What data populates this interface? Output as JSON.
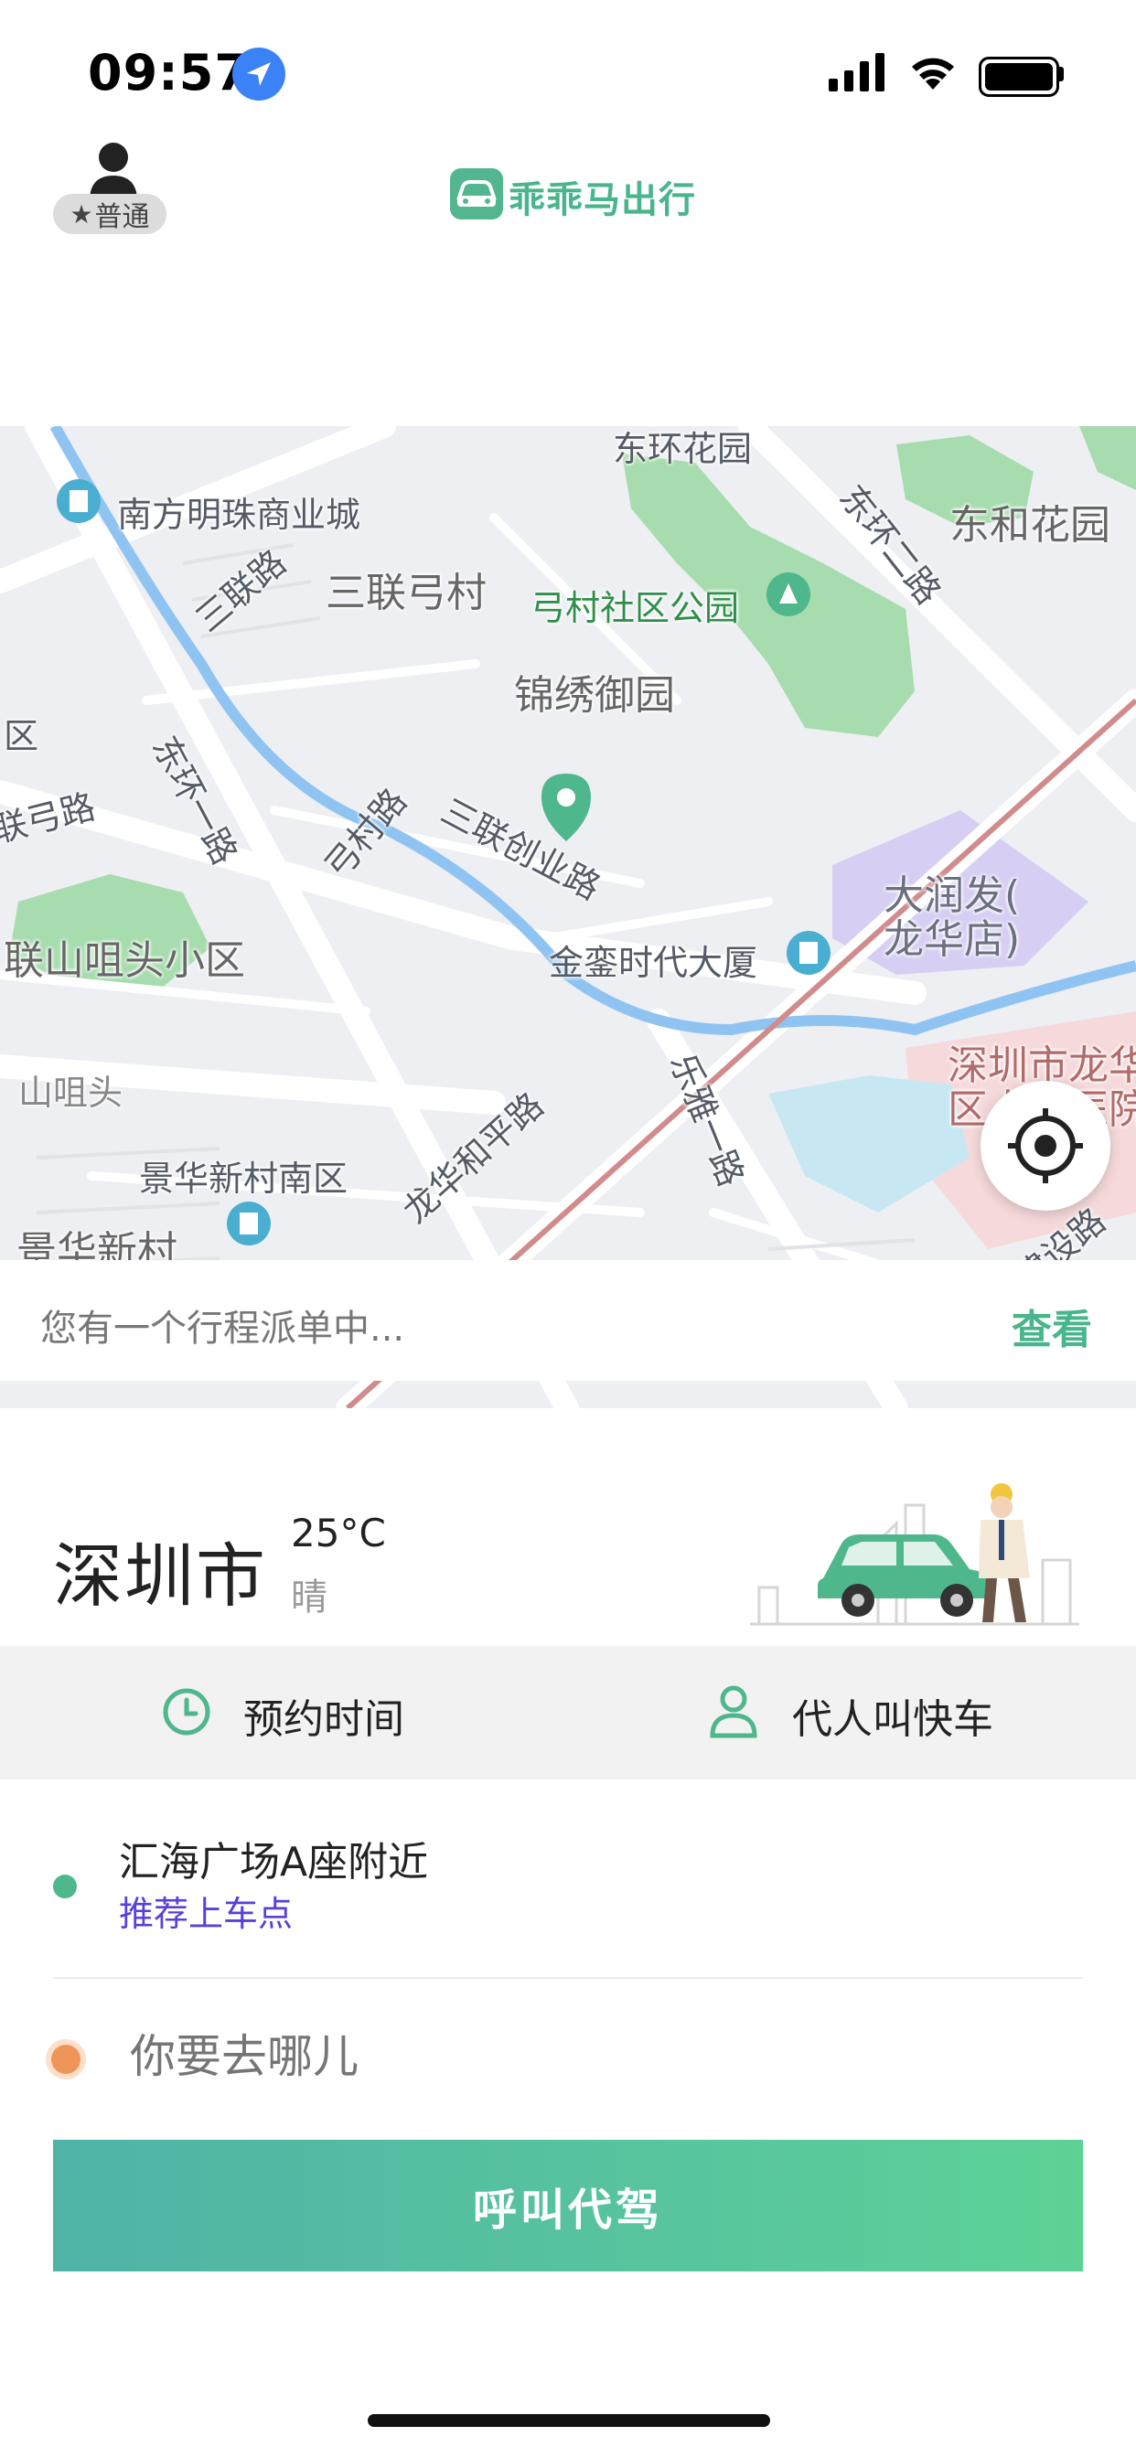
{
  "status_bar": {
    "time": "09:57",
    "icons": [
      "location-arrow-icon",
      "cellular-signal-icon",
      "wifi-icon",
      "battery-icon"
    ]
  },
  "header": {
    "member_badge": "普通",
    "member_icon": "star-icon",
    "avatar_icon": "user-avatar-icon",
    "logo_text": "乖乖马出行",
    "logo_icon": "car-logo-icon"
  },
  "map": {
    "labels": {
      "nanfang": "南方明珠商业城",
      "sanlian_road": "三联路",
      "sanlian_gongcun": "三联弓村",
      "gongcun_park": "弓村社区公园",
      "donghuan_road_top": "东环二路",
      "donghe_garden": "东和花园",
      "jinxiu": "锦绣御园",
      "qu": "区",
      "lian_gong_road": "联弓路",
      "donghuan_yilu": "东环一路",
      "gongcun_road": "弓村路",
      "sanlian_chuangye": "三联创业路",
      "darunfa": "大润发(\n龙华店)",
      "jinluan": "金銮时代大厦",
      "lianshan": "联山咀头小区",
      "shanjutou": "山咀头",
      "shenzhen_hospital": "深圳市龙华\n区人民医院",
      "leya_road": "乐雅一路",
      "longhua_heping": "龙华和平路",
      "jinghua_south": "景华新村南区",
      "jinghua": "景华新村",
      "jianshe_road": "建设路",
      "donghuan_garden_top": "东环花园"
    },
    "colors": {
      "park": "#a7dcae",
      "river": "#8fc4f2",
      "rail": "#d28b8b",
      "mall": "#d6cff3",
      "hospital": "#f6dadb"
    }
  },
  "trip_notice": {
    "text": "您有一个行程派单中...",
    "action": "查看"
  },
  "weather": {
    "city": "深圳市",
    "temperature": "25°C",
    "condition": "晴"
  },
  "options": {
    "schedule_label": "预约时间",
    "schedule_icon": "clock-icon",
    "proxy_label": "代人叫快车",
    "proxy_icon": "person-icon"
  },
  "pickup": {
    "address": "汇海广场A座附近",
    "hint": "推荐上车点"
  },
  "destination": {
    "placeholder": "你要去哪儿"
  },
  "call_button": "呼叫代驾"
}
